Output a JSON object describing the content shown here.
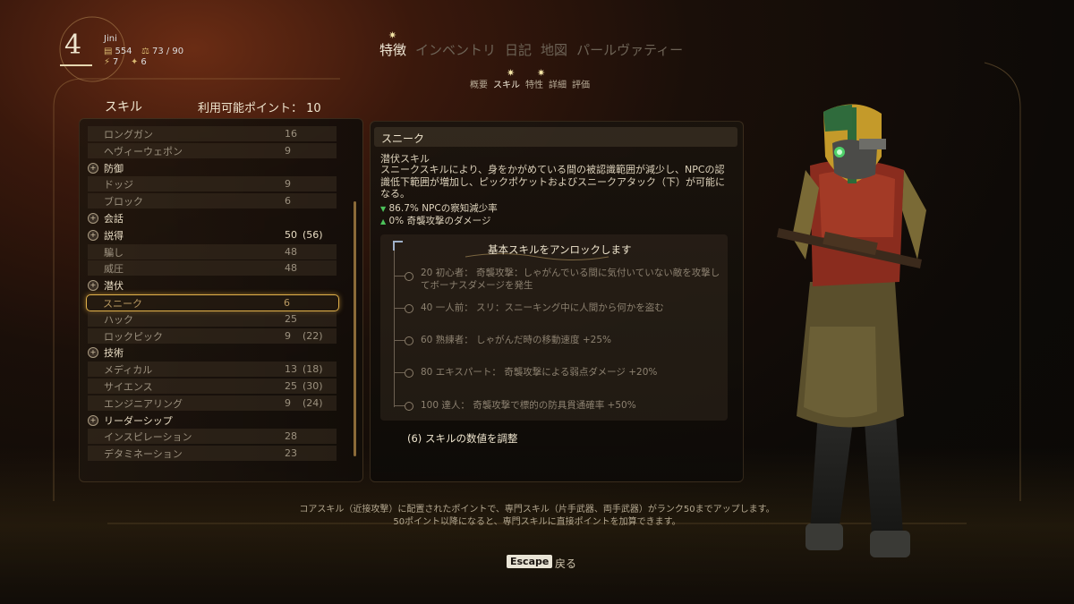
{
  "player": {
    "level": "4",
    "name": "Jini",
    "bits": "554",
    "weight": "73 / 90",
    "stat_a": "7",
    "stat_b": "6"
  },
  "tabs": [
    "特徴",
    "インベントリ",
    "日記",
    "地図",
    "パールヴァティー"
  ],
  "active_tab": "特徴",
  "subtabs": [
    "概要",
    "スキル",
    "特性",
    "詳細",
    "評価"
  ],
  "skills_panel": {
    "title": "スキル",
    "points_label": "利用可能ポイント：",
    "points_value": "10",
    "rows": [
      {
        "type": "sub",
        "name": "ロングガン",
        "value": "16",
        "bonus": ""
      },
      {
        "type": "sub",
        "name": "ヘヴィーウェポン",
        "value": "9",
        "bonus": ""
      },
      {
        "type": "cat",
        "name": "防御",
        "value": "",
        "bonus": ""
      },
      {
        "type": "sub",
        "name": "ドッジ",
        "value": "9",
        "bonus": ""
      },
      {
        "type": "sub",
        "name": "ブロック",
        "value": "6",
        "bonus": ""
      },
      {
        "type": "cat",
        "name": "会話",
        "value": "",
        "bonus": ""
      },
      {
        "type": "cat",
        "name": "説得",
        "value": "50",
        "bonus": "(56)"
      },
      {
        "type": "sub",
        "name": "騙し",
        "value": "48",
        "bonus": ""
      },
      {
        "type": "sub",
        "name": "威圧",
        "value": "48",
        "bonus": ""
      },
      {
        "type": "cat",
        "name": "潜伏",
        "value": "",
        "bonus": ""
      },
      {
        "type": "selected",
        "name": "スニーク",
        "value": "6",
        "bonus": ""
      },
      {
        "type": "sub",
        "name": "ハック",
        "value": "25",
        "bonus": ""
      },
      {
        "type": "sub",
        "name": "ロックピック",
        "value": "9",
        "bonus": "(22)"
      },
      {
        "type": "cat",
        "name": "技術",
        "value": "",
        "bonus": ""
      },
      {
        "type": "sub",
        "name": "メディカル",
        "value": "13",
        "bonus": "(18)"
      },
      {
        "type": "sub",
        "name": "サイエンス",
        "value": "25",
        "bonus": "(30)"
      },
      {
        "type": "sub",
        "name": "エンジニアリング",
        "value": "9",
        "bonus": "(24)"
      },
      {
        "type": "cat",
        "name": "リーダーシップ",
        "value": "",
        "bonus": ""
      },
      {
        "type": "sub",
        "name": "インスピレーション",
        "value": "28",
        "bonus": ""
      },
      {
        "type": "sub",
        "name": "デタミネーション",
        "value": "23",
        "bonus": ""
      }
    ]
  },
  "detail": {
    "title": "スニーク",
    "category": "潜伏スキル",
    "description": "スニークスキルにより、身をかがめている間の被認識範囲が減少し、NPCの認識低下範囲が増加し、ピックポケットおよびスニークアタック（下）が可能になる。",
    "effect1": "86.7% NPCの察知減少率",
    "effect2": "0% 奇襲攻撃のダメージ",
    "unlock_title": "基本スキルをアンロックします",
    "unlocks": [
      "20 初心者： 奇襲攻撃：しゃがんでいる間に気付いていない敵を攻撃してボーナスダメージを発生",
      "40 一人前： スリ：スニーキング中に人間から何かを盗む",
      "60 熟練者： しゃがんだ時の移動速度 +25%",
      "80 エキスパート： 奇襲攻撃による弱点ダメージ +20%",
      "100 達人： 奇襲攻撃で標的の防具貫通確率 +50%"
    ],
    "adjust_label": "(6) スキルの数値を調整"
  },
  "footer": {
    "line1": "コアスキル（近接攻撃）に配置されたポイントで、専門スキル（片手武器、両手武器）がランク50までアップします。",
    "line2": "50ポイント以降になると、専門スキルに直接ポイントを加算できます。",
    "escape_key": "Escape",
    "back_label": "戻る"
  },
  "colors": {
    "accent_gold": "#e0b04a",
    "effect_green": "#4cc25a"
  },
  "progress": {
    "level_xp_fraction": 1.0
  }
}
